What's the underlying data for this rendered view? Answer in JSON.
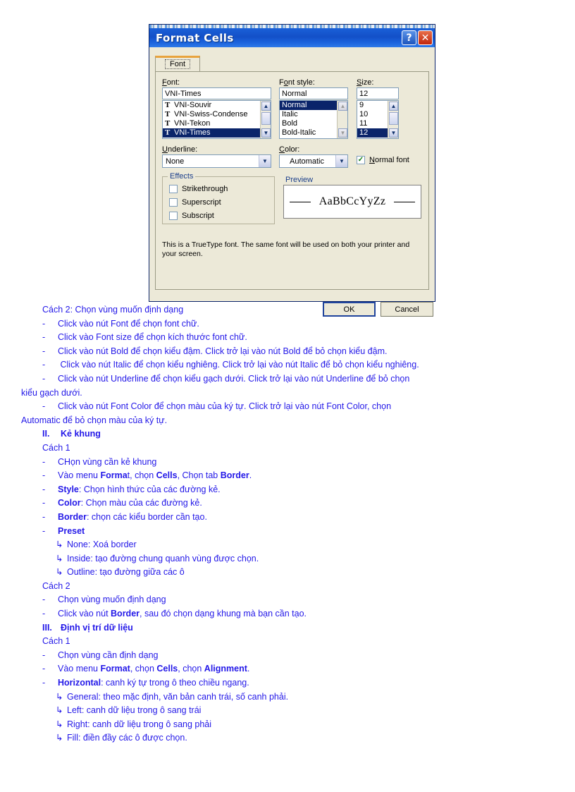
{
  "dialog": {
    "title": "Format Cells",
    "help_button": "?",
    "close_button": "✕",
    "tab": "Font",
    "font": {
      "label": "Font:",
      "value": "VNI-Times",
      "items": [
        {
          "icon": "truetype-icon",
          "name": "VNI-Souvir",
          "selected": false
        },
        {
          "icon": "truetype-icon",
          "name": "VNI-Swiss-Condense",
          "selected": false
        },
        {
          "icon": "truetype-icon",
          "name": "VNI-Tekon",
          "selected": false
        },
        {
          "icon": "truetype-icon",
          "name": "VNI-Times",
          "selected": true
        }
      ]
    },
    "font_style": {
      "label": "Font style:",
      "value": "Normal",
      "items": [
        {
          "name": "Normal",
          "selected": true
        },
        {
          "name": "Italic",
          "selected": false
        },
        {
          "name": "Bold",
          "selected": false
        },
        {
          "name": "Bold-Italic",
          "selected": false
        }
      ]
    },
    "size": {
      "label": "Size:",
      "value": "12",
      "items": [
        {
          "name": "9",
          "selected": false
        },
        {
          "name": "10",
          "selected": false
        },
        {
          "name": "11",
          "selected": false
        },
        {
          "name": "12",
          "selected": true
        }
      ]
    },
    "underline": {
      "label": "Underline:",
      "value": "None"
    },
    "color": {
      "label": "Color:",
      "value": "Automatic"
    },
    "normal_font": {
      "label": "Normal font",
      "checked": true,
      "check_glyph": "✓"
    },
    "effects": {
      "title": "Effects",
      "items": [
        {
          "label": "Strikethrough",
          "checked": false
        },
        {
          "label": "Superscript",
          "checked": false
        },
        {
          "label": "Subscript",
          "checked": false
        }
      ]
    },
    "preview": {
      "title": "Preview",
      "sample": "AaBbCcYyZz"
    },
    "info": "This is a TrueType font.  The same font will be used on both your printer and your screen.",
    "buttons": {
      "ok": "OK",
      "cancel": "Cancel"
    }
  },
  "document": {
    "text_color": "#2318e8",
    "lines": [
      {
        "id": "l01",
        "type": "plain",
        "text": "Cách 2: Chọn vùng muốn định dạng"
      },
      {
        "id": "l02",
        "type": "dash",
        "bullet": "-",
        "text": "Click vào nút Font để chọn font chữ."
      },
      {
        "id": "l03",
        "type": "dash",
        "bullet": "-",
        "text": "Click vào Font size để chọn kích thước font chữ."
      },
      {
        "id": "l04",
        "type": "dash",
        "bullet": "-",
        "text": "Click vào nút Bold để chọn kiểu đậm. Click trở lại vào nút Bold để bỏ chọn kiểu đậm."
      },
      {
        "id": "l05",
        "type": "dash",
        "bullet": "-",
        "text": " Click vào nút Italic để chọn kiểu nghiêng. Click trở lại vào nút Italic để bỏ chọn kiểu nghiêng."
      },
      {
        "id": "l06",
        "type": "dash-justify",
        "bullet": "-",
        "text": "Click vào nút Underline để chọn kiểu gạch dưới. Click trở lại vào nút Underline để bỏ chọn"
      },
      {
        "id": "l07",
        "type": "wrap",
        "text": "kiểu gạch dưới."
      },
      {
        "id": "l08",
        "type": "dash-justify",
        "bullet": "-",
        "text": "Click vào nút Font Color để chọn màu của ký tự. Click trở lại vào nút Font Color, chọn"
      },
      {
        "id": "l09",
        "type": "wrap",
        "text": "Automatic để bỏ chọn màu của ký tự."
      },
      {
        "id": "l10",
        "type": "heading",
        "num": "II.",
        "text": "Kẻ khung"
      },
      {
        "id": "l11",
        "type": "plain",
        "text": "Cách 1"
      },
      {
        "id": "l12",
        "type": "dash",
        "bullet": "-",
        "text": "CHọn vùng cần kẻ khung"
      },
      {
        "id": "l13",
        "type": "dash-rich",
        "bullet": "-",
        "parts": [
          {
            "t": "Vào menu ",
            "b": false
          },
          {
            "t": "Forma",
            "b": true
          },
          {
            "t": "t, chọn ",
            "b": false
          },
          {
            "t": "Cells",
            "b": true
          },
          {
            "t": ", Chọn tab ",
            "b": false
          },
          {
            "t": "Border",
            "b": true
          },
          {
            "t": ".",
            "b": false
          }
        ]
      },
      {
        "id": "l14",
        "type": "dash-rich",
        "bullet": "-",
        "parts": [
          {
            "t": "Style",
            "b": true
          },
          {
            "t": ": Chọn hình thức của các đường kẻ.",
            "b": false
          }
        ]
      },
      {
        "id": "l15",
        "type": "dash-rich",
        "bullet": "-",
        "parts": [
          {
            "t": "Color",
            "b": true
          },
          {
            "t": ": Chọn màu của các đường kẻ.",
            "b": false
          }
        ]
      },
      {
        "id": "l16",
        "type": "dash-rich",
        "bullet": "-",
        "parts": [
          {
            "t": "Border",
            "b": true
          },
          {
            "t": ": chọn các kiểu border cần tạo.",
            "b": false
          }
        ]
      },
      {
        "id": "l17",
        "type": "dash-rich",
        "bullet": "-",
        "parts": [
          {
            "t": "Preset",
            "b": true
          }
        ]
      },
      {
        "id": "l18",
        "type": "arrow",
        "bullet": "↳",
        "text": "None: Xoá border"
      },
      {
        "id": "l19",
        "type": "arrow",
        "bullet": "↳",
        "text": "Inside: tạo đường chung quanh vùng được chọn."
      },
      {
        "id": "l20",
        "type": "arrow",
        "bullet": "↳",
        "text": "Outline: tạo đường giữa các ô"
      },
      {
        "id": "l21",
        "type": "plain",
        "text": "Cách 2"
      },
      {
        "id": "l22",
        "type": "dash",
        "bullet": "-",
        "text": "Chọn vùng muốn định dạng"
      },
      {
        "id": "l23",
        "type": "dash-rich",
        "bullet": "-",
        "parts": [
          {
            "t": "Click vào nút ",
            "b": false
          },
          {
            "t": "Border",
            "b": true
          },
          {
            "t": ", sau đó chọn dạng khung mà bạn cần tạo.",
            "b": false
          }
        ]
      },
      {
        "id": "l24",
        "type": "heading",
        "num": "III.",
        "text": "Định vị trí dữ liệu"
      },
      {
        "id": "l25",
        "type": "plain",
        "text": "Cách 1"
      },
      {
        "id": "l26",
        "type": "dash",
        "bullet": "-",
        "text": "Chọn vùng cần định dạng"
      },
      {
        "id": "l27",
        "type": "dash-rich",
        "bullet": "-",
        "parts": [
          {
            "t": "Vào menu ",
            "b": false
          },
          {
            "t": "Format",
            "b": true
          },
          {
            "t": ", chọn ",
            "b": false
          },
          {
            "t": "Cells",
            "b": true
          },
          {
            "t": ", chọn ",
            "b": false
          },
          {
            "t": "Alignment",
            "b": true
          },
          {
            "t": ".",
            "b": false
          }
        ]
      },
      {
        "id": "l28",
        "type": "dash-rich",
        "bullet": "-",
        "parts": [
          {
            "t": "Horizontal",
            "b": true
          },
          {
            "t": ": canh ký tự trong ô theo chiều ngang.",
            "b": false
          }
        ]
      },
      {
        "id": "l29",
        "type": "arrow",
        "bullet": "↳",
        "text": "General: theo mặc định, văn bản canh trái, số canh phải."
      },
      {
        "id": "l30",
        "type": "arrow",
        "bullet": "↳",
        "text": "Left: canh dữ liệu trong ô sang trái"
      },
      {
        "id": "l31",
        "type": "arrow",
        "bullet": "↳",
        "text": "Right: canh dữ liệu trong ô sang phải"
      },
      {
        "id": "l32",
        "type": "arrow",
        "bullet": "↳",
        "text": "Fill: điền đầy các ô được chọn."
      }
    ]
  }
}
